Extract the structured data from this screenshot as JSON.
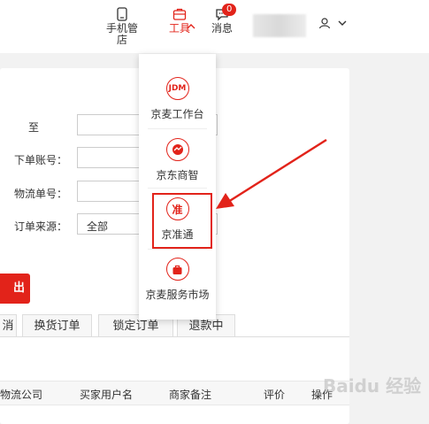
{
  "topbar": {
    "phone_store": "手机管店",
    "tools": "工具",
    "messages": "消息",
    "message_count": "0",
    "user_arrow": "⌄"
  },
  "form": {
    "to_label": "至",
    "order_account_label": "下单账号：",
    "logistics_no_label": "物流单号：",
    "order_source_label": "订单来源：",
    "order_source_value": "全部"
  },
  "export_button": "出",
  "tabs": [
    "消",
    "换货订单",
    "锁定订单",
    "退款中"
  ],
  "table_headers": [
    "物流公司",
    "买家用户名",
    "商家备注",
    "评价",
    "操作"
  ],
  "dropdown": {
    "items": [
      {
        "label": "京麦工作台",
        "icon_text": "JDM",
        "icon": "jdm-icon"
      },
      {
        "label": "京东商智",
        "icon_text": "",
        "icon": "jd-shangzhi-icon"
      },
      {
        "label": "京准通",
        "icon_text": "准",
        "icon": "jingzhuntong-icon"
      },
      {
        "label": "京麦服务市场",
        "icon_text": "",
        "icon": "service-market-icon"
      }
    ]
  },
  "watermark": "Baidu 经验",
  "colors": {
    "accent": "#e2231a"
  }
}
